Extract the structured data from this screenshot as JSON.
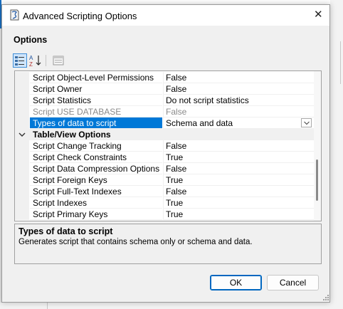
{
  "window": {
    "title": "Advanced Scripting Options"
  },
  "section_label": "Options",
  "toolbar": {
    "categorized_icon": "categorized-icon",
    "alphabetical_icon": "alphabetical-sort-icon",
    "property_pages_icon": "property-pages-icon"
  },
  "grid": {
    "rows": [
      {
        "name": "Script Object-Level Permissions",
        "value": "False"
      },
      {
        "name": "Script Owner",
        "value": "False"
      },
      {
        "name": "Script Statistics",
        "value": "Do not script statistics"
      },
      {
        "name": "Script USE DATABASE",
        "value": "False",
        "disabled": true
      },
      {
        "name": "Types of data to script",
        "value": "Schema and data",
        "selected": true
      },
      {
        "category": "Table/View Options"
      },
      {
        "name": "Script Change Tracking",
        "value": "False"
      },
      {
        "name": "Script Check Constraints",
        "value": "True"
      },
      {
        "name": "Script Data Compression Options",
        "value": "False"
      },
      {
        "name": "Script Foreign Keys",
        "value": "True"
      },
      {
        "name": "Script Full-Text Indexes",
        "value": "False"
      },
      {
        "name": "Script Indexes",
        "value": "True"
      },
      {
        "name": "Script Primary Keys",
        "value": "True"
      }
    ]
  },
  "description": {
    "title": "Types of data to script",
    "text": "Generates script that contains schema only or schema and data."
  },
  "buttons": {
    "ok": "OK",
    "cancel": "Cancel"
  },
  "colors": {
    "selection": "#0078d7",
    "dialog_bg": "#f0f0f0",
    "ok_border": "#0067c0"
  }
}
